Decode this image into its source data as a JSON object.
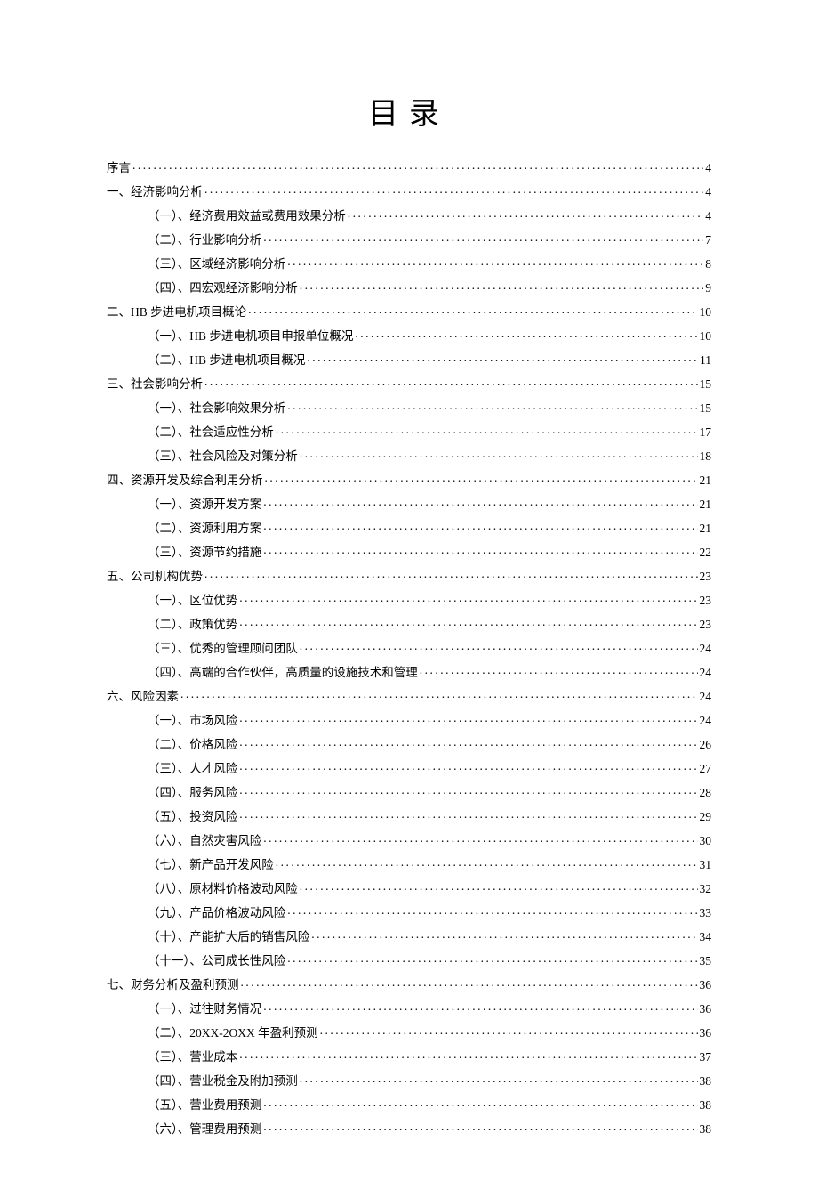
{
  "title": "目录",
  "toc": [
    {
      "level": 1,
      "label": "序言",
      "page": "4"
    },
    {
      "level": 1,
      "label": "一、经济影响分析",
      "page": "4"
    },
    {
      "level": 2,
      "label": "（一）、经济费用效益或费用效果分析",
      "page": "4"
    },
    {
      "level": 2,
      "label": "（二）、行业影响分析",
      "page": "7"
    },
    {
      "level": 2,
      "label": "（三）、区域经济影响分析",
      "page": "8"
    },
    {
      "level": 2,
      "label": "（四）、四宏观经济影响分析",
      "page": "9"
    },
    {
      "level": 1,
      "label": "二、HB 步进电机项目概论",
      "page": "10"
    },
    {
      "level": 2,
      "label": "（一）、HB 步进电机项目申报单位概况",
      "page": "10"
    },
    {
      "level": 2,
      "label": "（二）、HB 步进电机项目概况",
      "page": "11"
    },
    {
      "level": 1,
      "label": "三、社会影响分析",
      "page": "15"
    },
    {
      "level": 2,
      "label": "（一）、社会影响效果分析",
      "page": "15"
    },
    {
      "level": 2,
      "label": "（二）、社会适应性分析",
      "page": "17"
    },
    {
      "level": 2,
      "label": "（三）、社会风险及对策分析",
      "page": "18"
    },
    {
      "level": 1,
      "label": "四、资源开发及综合利用分析",
      "page": "21"
    },
    {
      "level": 2,
      "label": "（一）、资源开发方案",
      "page": "21"
    },
    {
      "level": 2,
      "label": "（二）、资源利用方案",
      "page": "21"
    },
    {
      "level": 2,
      "label": "（三）、资源节约措施",
      "page": "22"
    },
    {
      "level": 1,
      "label": "五、公司机构优势",
      "page": "23"
    },
    {
      "level": 2,
      "label": "（一）、区位优势",
      "page": "23"
    },
    {
      "level": 2,
      "label": "（二）、政策优势",
      "page": "23"
    },
    {
      "level": 2,
      "label": "（三）、优秀的管理顾问团队",
      "page": "24"
    },
    {
      "level": 2,
      "label": "（四）、高端的合作伙伴，高质量的设施技术和管理",
      "page": "24"
    },
    {
      "level": 1,
      "label": "六、风险因素",
      "page": "24"
    },
    {
      "level": 2,
      "label": "（一）、市场风险",
      "page": "24"
    },
    {
      "level": 2,
      "label": "（二）、价格风险",
      "page": "26"
    },
    {
      "level": 2,
      "label": "（三）、人才风险",
      "page": "27"
    },
    {
      "level": 2,
      "label": "（四）、服务风险",
      "page": "28"
    },
    {
      "level": 2,
      "label": "（五）、投资风险",
      "page": "29"
    },
    {
      "level": 2,
      "label": "（六）、自然灾害风险",
      "page": "30"
    },
    {
      "level": 2,
      "label": "（七）、新产品开发风险",
      "page": "31"
    },
    {
      "level": 2,
      "label": "（八）、原材料价格波动风险",
      "page": "32"
    },
    {
      "level": 2,
      "label": "（九）、产品价格波动风险",
      "page": "33"
    },
    {
      "level": 2,
      "label": "（十）、产能扩大后的销售风险",
      "page": "34"
    },
    {
      "level": 2,
      "label": "（十一）、公司成长性风险",
      "page": "35"
    },
    {
      "level": 1,
      "label": "七、财务分析及盈利预测",
      "page": "36"
    },
    {
      "level": 2,
      "label": "（一）、过往财务情况",
      "page": "36"
    },
    {
      "level": 2,
      "label": "（二）、20XX-2OXX 年盈利预测",
      "page": "36"
    },
    {
      "level": 2,
      "label": "（三）、营业成本",
      "page": "37"
    },
    {
      "level": 2,
      "label": "（四）、营业税金及附加预测",
      "page": "38"
    },
    {
      "level": 2,
      "label": "（五）、营业费用预测",
      "page": "38"
    },
    {
      "level": 2,
      "label": "（六）、管理费用预测",
      "page": "38"
    }
  ]
}
